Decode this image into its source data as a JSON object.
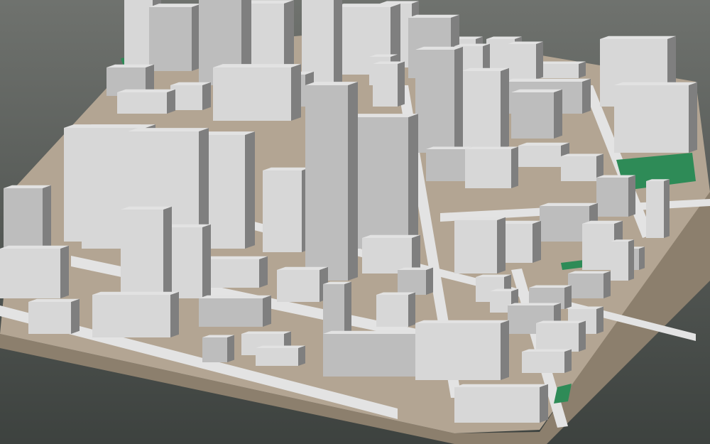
{
  "scene": {
    "subject": "3d-city-block-model",
    "colors": {
      "background_top": "#6f726e",
      "background_bottom": "#3d423f",
      "base_top": "#b3a593",
      "base_side": "#8c7f6d",
      "street": "#e3e3e3",
      "building_light": "#d7d7d7",
      "building_mid": "#bdbdbd",
      "building_dark": "#7f7f7f",
      "park": "#2e8b57"
    }
  }
}
